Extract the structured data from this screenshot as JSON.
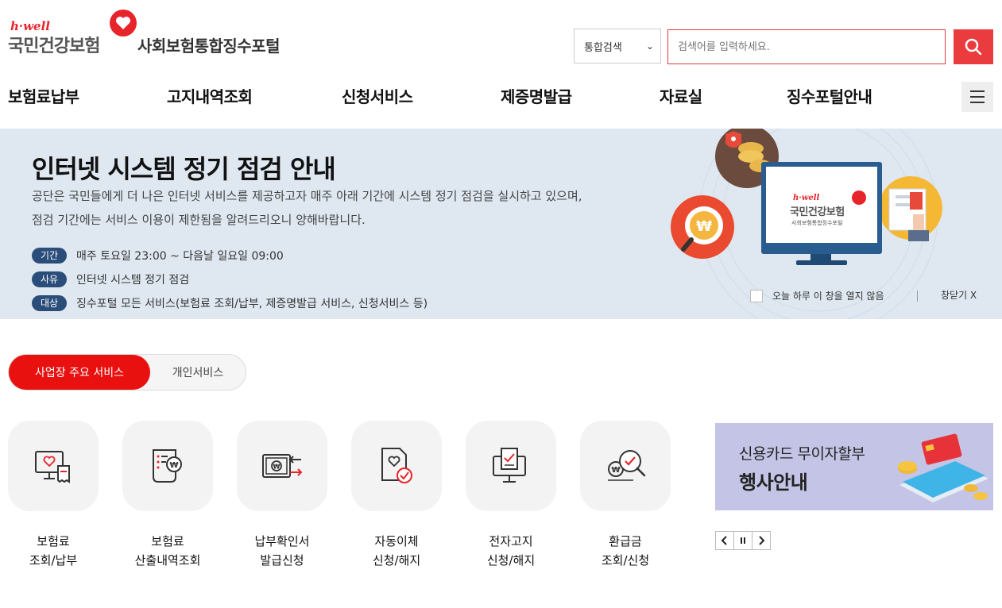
{
  "header": {
    "logo_small": "h·well",
    "logo_brand": "국민건강보험",
    "portal_title": "사회보험통합징수포털",
    "search_scope": "통합검색",
    "search_placeholder": "검색어를 입력하세요."
  },
  "nav": [
    "보험료납부",
    "고지내역조회",
    "신청서비스",
    "제증명발급",
    "자료실",
    "징수포털안내"
  ],
  "notice": {
    "title": "인터넷 시스템 정기 점검 안내",
    "desc_line1": "공단은 국민들에게 더 나은 인터넷 서비스를 제공하고자 매주 아래 기간에 시스템 정기 점검을 실시하고 있으며,",
    "desc_line2": "점검 기간에는 서비스 이용이 제한됨을 알려드리오니 양해바랍니다.",
    "rows": [
      {
        "tag": "기간",
        "text": "매주 토요일 23:00 ~ 다음날 일요일 09:00"
      },
      {
        "tag": "사유",
        "text": "인터넷 시스템 정기 점검"
      },
      {
        "tag": "대상",
        "text": "징수포털 모든 서비스(보험료 조회/납부, 제증명발급 서비스, 신청서비스 등)"
      }
    ],
    "dont_show": "오늘 하루 이 창을 열지 않음",
    "close": "창닫기 X",
    "monitor_brand": "국민건강보험",
    "monitor_small": "h·well",
    "monitor_sub": "사회보험통합징수포털"
  },
  "tabs": {
    "active": "사업장 주요 서비스",
    "inactive": "개인서비스"
  },
  "services": [
    {
      "line1": "보험료",
      "line2": "조회/납부",
      "icon": "monitor-heart-receipt-icon"
    },
    {
      "line1": "보험료",
      "line2": "산출내역조회",
      "icon": "document-won-icon"
    },
    {
      "line1": "납부확인서",
      "line2": "발급신청",
      "icon": "bill-exchange-icon"
    },
    {
      "line1": "자동이체",
      "line2": "신청/해지",
      "icon": "document-check-icon"
    },
    {
      "line1": "전자고지",
      "line2": "신청/해지",
      "icon": "monitor-check-icon"
    },
    {
      "line1": "환급금",
      "line2": "조회/신청",
      "icon": "magnifier-won-icon"
    }
  ],
  "promo": {
    "line1": "신용카드 무이자할부",
    "line2": "행사안내"
  },
  "colors": {
    "accent": "#e8110f",
    "navy": "#2b4d7a",
    "banner_bg": "#dfe8f1",
    "promo_bg": "#c4c5e6"
  }
}
